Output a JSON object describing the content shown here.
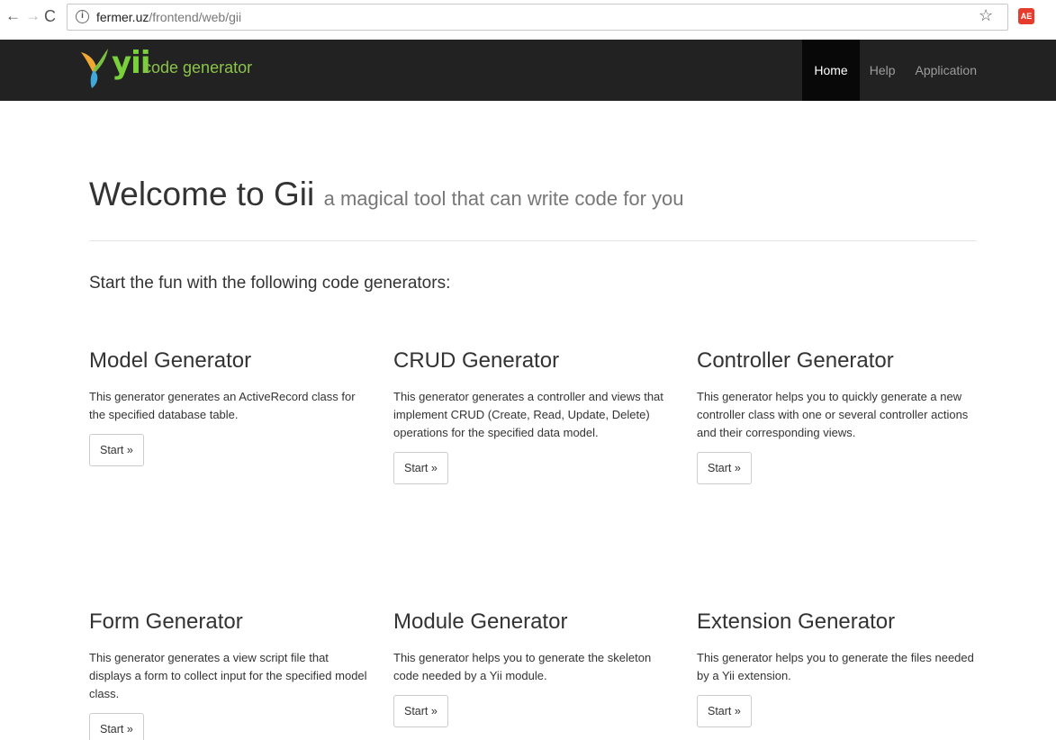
{
  "browser": {
    "back_glyph": "←",
    "forward_glyph": "→",
    "reload_glyph": "C",
    "url_host": "fermer.uz",
    "url_path": "/frontend/web/gii",
    "extension_label": "AE",
    "icons": [
      "back-arrow-icon",
      "forward-arrow-icon",
      "reload-icon",
      "info-icon",
      "bookmark-star-icon"
    ]
  },
  "navbar": {
    "brand_yii": "yii",
    "brand_label": "code generator",
    "items": [
      {
        "label": "Home",
        "active": true
      },
      {
        "label": "Help",
        "active": false
      },
      {
        "label": "Application",
        "active": false
      }
    ],
    "colors": {
      "background": "#222222",
      "active_background": "#080808",
      "brand": "#8bc34a"
    }
  },
  "page": {
    "title": "Welcome to Gii",
    "subtitle": "a magical tool that can write code for you",
    "lead": "Start the fun with the following code generators:"
  },
  "generators": [
    {
      "title": "Model Generator",
      "description": "This generator generates an ActiveRecord class for the specified database table.",
      "button": "Start »"
    },
    {
      "title": "CRUD Generator",
      "description": "This generator generates a controller and views that implement CRUD (Create, Read, Update, Delete) operations for the specified data model.",
      "button": "Start »"
    },
    {
      "title": "Controller Generator",
      "description": "This generator helps you to quickly generate a new controller class with one or several controller actions and their corresponding views.",
      "button": "Start »"
    },
    {
      "title": "Form Generator",
      "description": "This generator generates a view script file that displays a form to collect input for the specified model class.",
      "button": "Start »"
    },
    {
      "title": "Module Generator",
      "description": "This generator helps you to generate the skeleton code needed by a Yii module.",
      "button": "Start »"
    },
    {
      "title": "Extension Generator",
      "description": "This generator helps you to generate the files needed by a Yii extension.",
      "button": "Start »"
    }
  ]
}
